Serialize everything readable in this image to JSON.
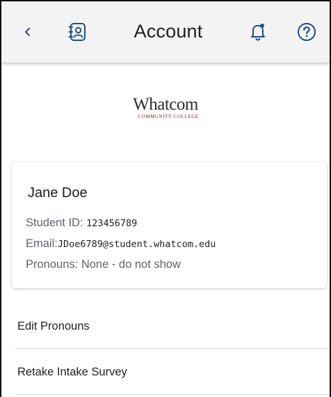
{
  "header": {
    "title": "Account",
    "icons": [
      "chevron-left-icon",
      "contact-book-icon",
      "bell-icon",
      "help-icon"
    ]
  },
  "logo": {
    "wordmark": "Whatcom",
    "tagline": "COMMUNITY COLLEGE",
    "tagline_color": "#8a1e2d"
  },
  "profile": {
    "name": "Jane Doe",
    "student_id_label": "Student ID:",
    "student_id_value": "123456789",
    "email_label": "Email:",
    "email_value": "JDoe6789@student.whatcom.edu",
    "pronouns_label": "Pronouns:",
    "pronouns_value": "None - do not show"
  },
  "menu": {
    "items": [
      {
        "label": "Edit Pronouns"
      },
      {
        "label": "Retake Intake Survey"
      }
    ]
  }
}
